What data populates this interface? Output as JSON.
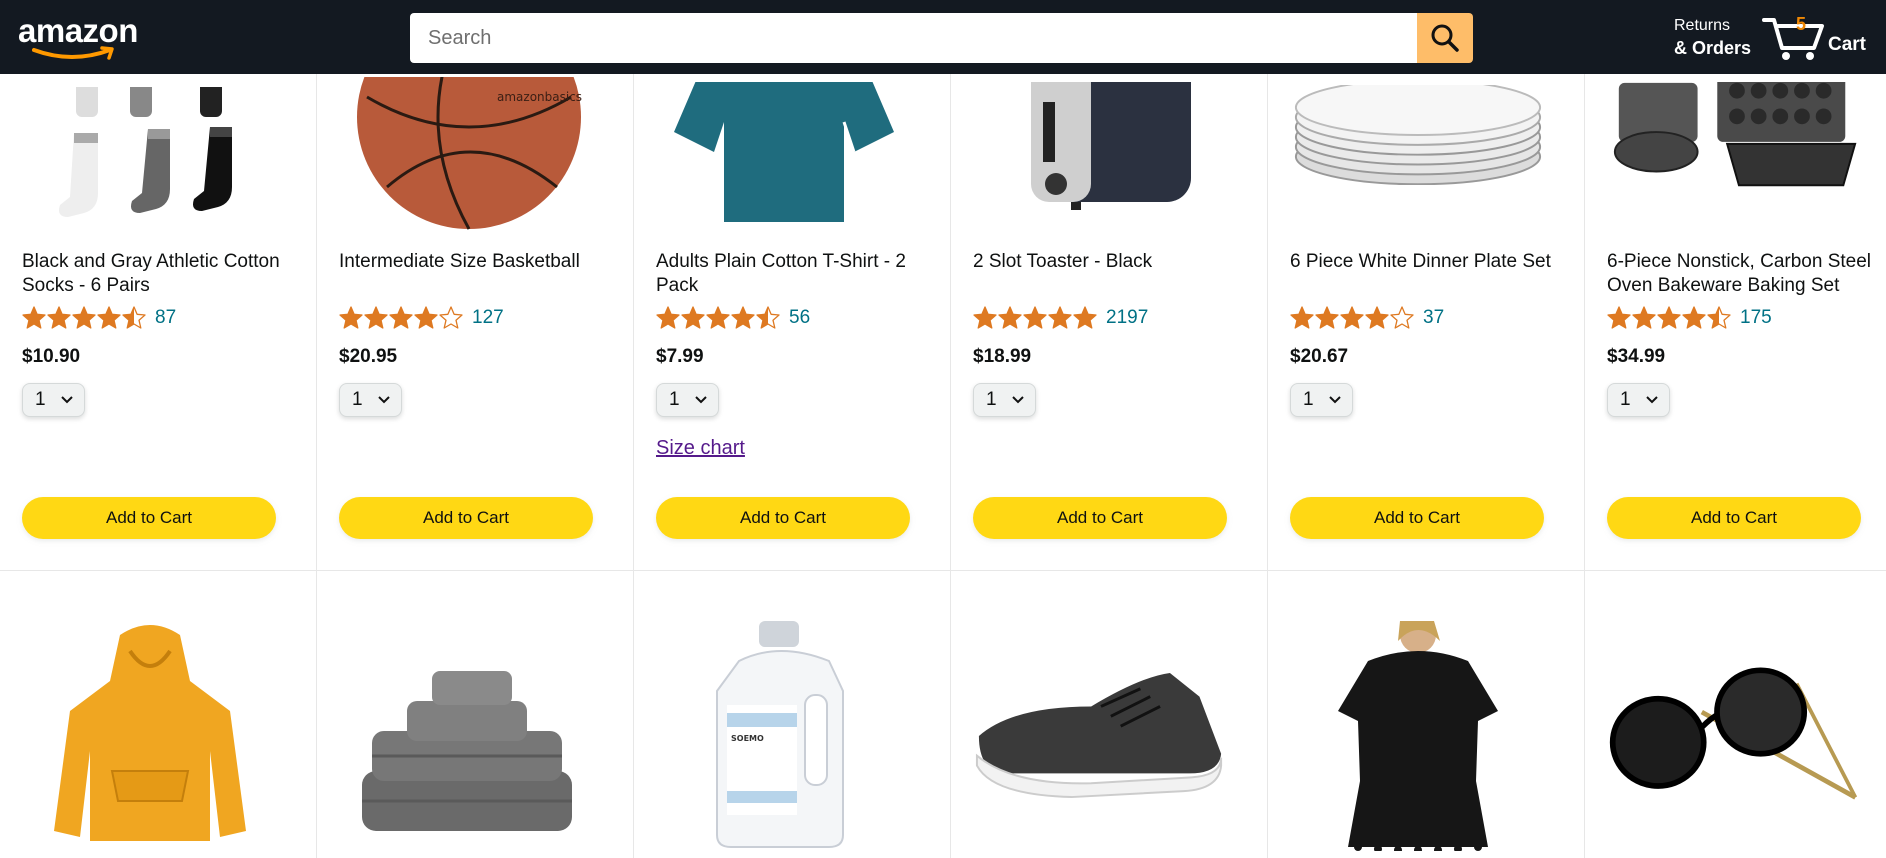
{
  "header": {
    "logo_text": "amazon",
    "search_placeholder": "Search",
    "returns_line1": "Returns",
    "returns_line2": "& Orders",
    "cart_count": "5",
    "cart_label": "Cart"
  },
  "products": [
    {
      "name": "Black and Gray Athletic Cotton Socks - 6 Pairs",
      "rating": 4.5,
      "count": "87",
      "price": "$10.90",
      "qty": "1",
      "add_label": "Add to Cart"
    },
    {
      "name": "Intermediate Size Basketball",
      "rating": 4.0,
      "count": "127",
      "price": "$20.95",
      "qty": "1",
      "add_label": "Add to Cart"
    },
    {
      "name": "Adults Plain Cotton T-Shirt - 2 Pack",
      "rating": 4.5,
      "count": "56",
      "price": "$7.99",
      "qty": "1",
      "size_chart": "Size chart",
      "add_label": "Add to Cart"
    },
    {
      "name": "2 Slot Toaster - Black",
      "rating": 5.0,
      "count": "2197",
      "price": "$18.99",
      "qty": "1",
      "add_label": "Add to Cart"
    },
    {
      "name": "6 Piece White Dinner Plate Set",
      "rating": 4.0,
      "count": "37",
      "price": "$20.67",
      "qty": "1",
      "add_label": "Add to Cart"
    },
    {
      "name": "6-Piece Nonstick, Carbon Steel Oven Bakeware Baking Set",
      "rating": 4.5,
      "count": "175",
      "price": "$34.99",
      "qty": "1",
      "add_label": "Add to Cart"
    }
  ],
  "row2": [
    "hoodie",
    "towels",
    "laundry-detergent",
    "sneaker",
    "beach-cover-up",
    "sunglasses"
  ],
  "colors": {
    "header_bg": "#131921",
    "search_btn": "#febd69",
    "add_to_cart": "#ffd814",
    "link": "#007185",
    "star": "#de7921"
  }
}
